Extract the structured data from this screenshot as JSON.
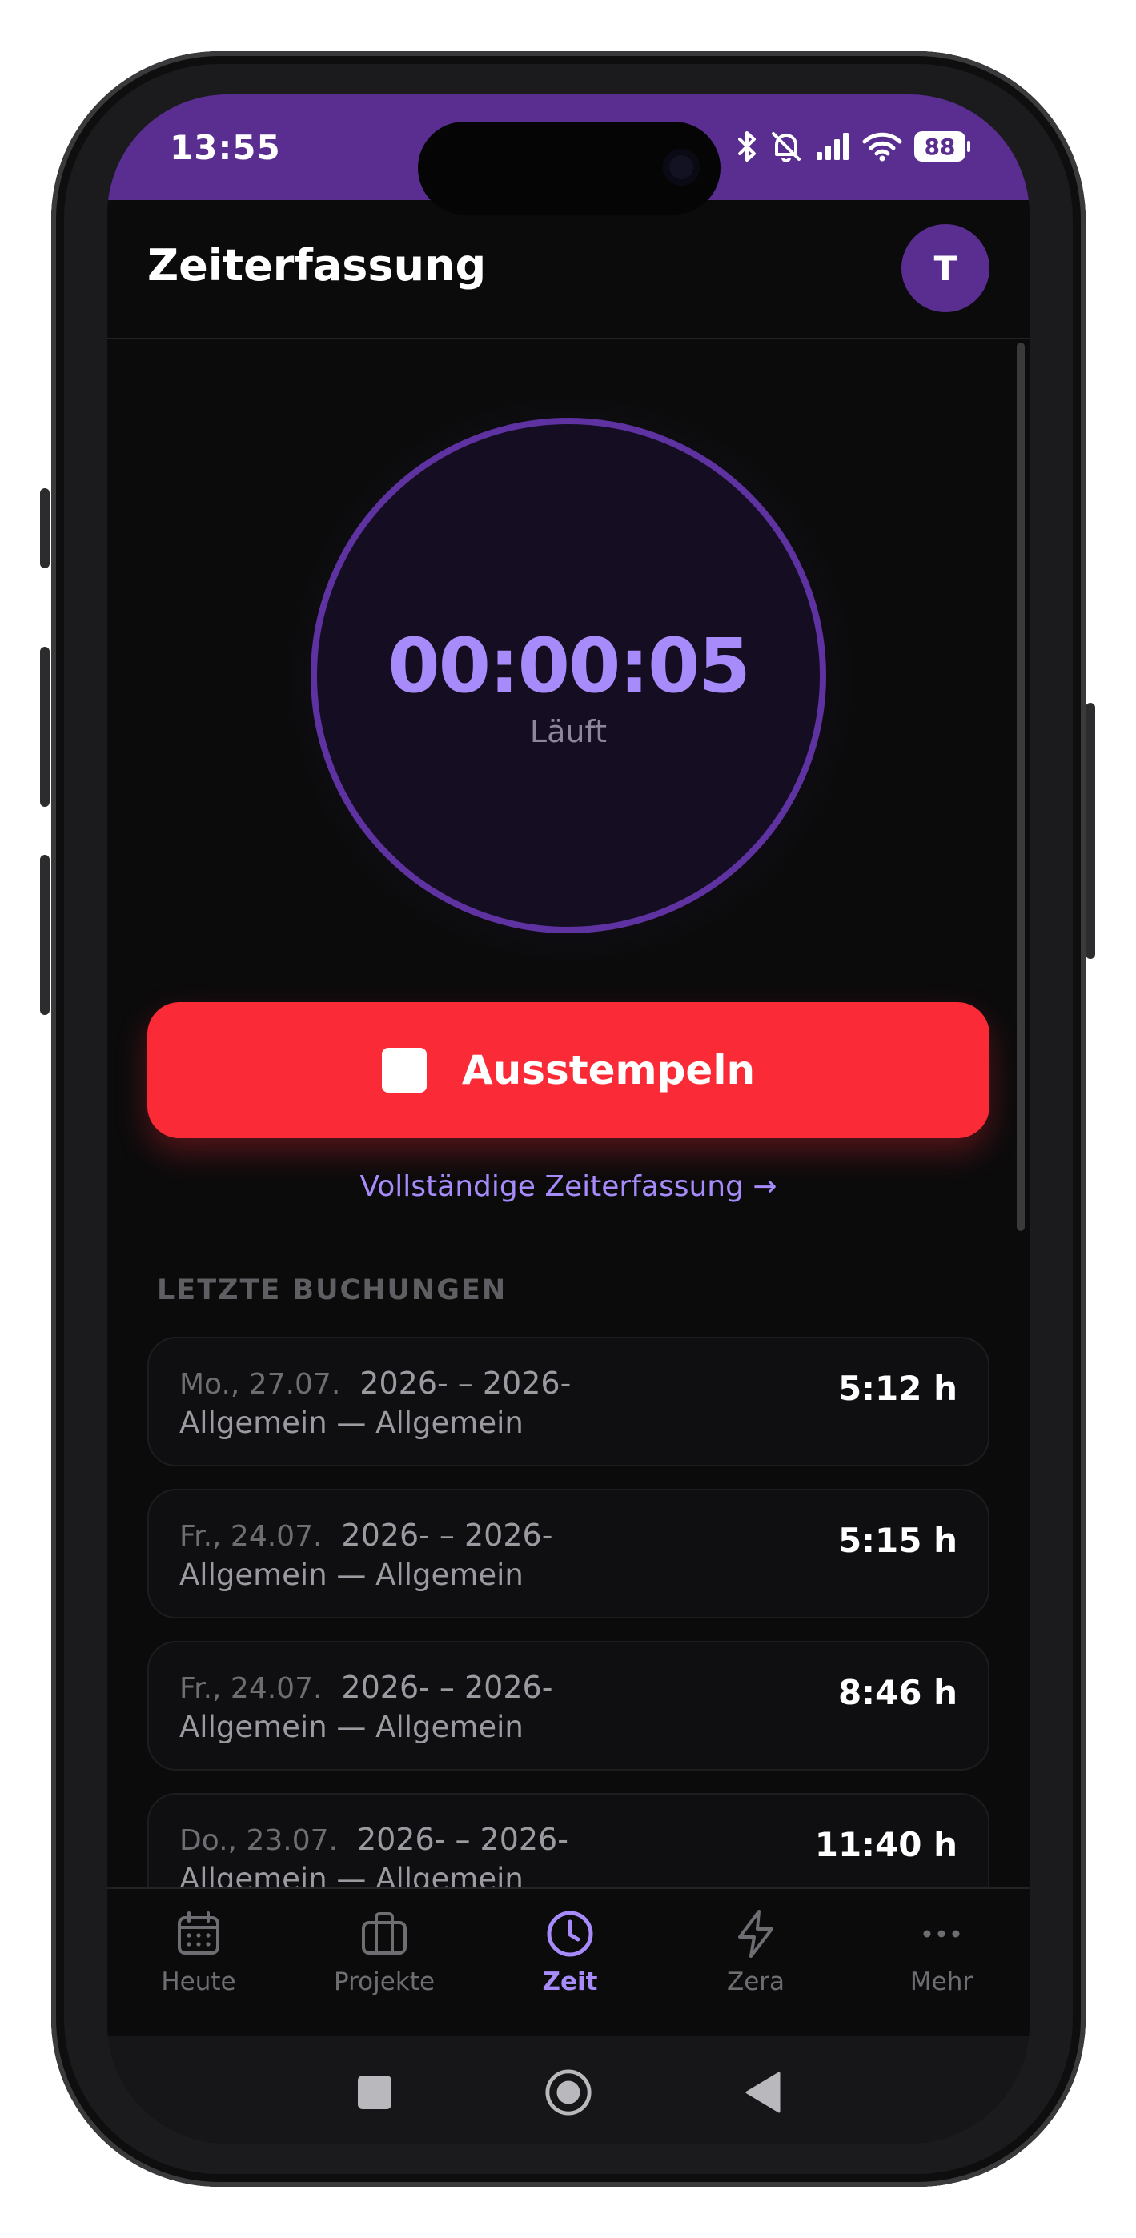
{
  "status_bar": {
    "time": "13:55",
    "battery": "88"
  },
  "header": {
    "title": "Zeiterfassung",
    "avatar_initial": "T"
  },
  "timer": {
    "elapsed": "00:00:05",
    "state": "Läuft"
  },
  "actions": {
    "clock_out_label": "Ausstempeln",
    "full_tracking_link": "Vollständige Zeiterfassung →"
  },
  "recent": {
    "heading": "LETZTE BUCHUNGEN",
    "items": [
      {
        "date": "Mo., 27.07.",
        "time_range": "2026- – 2026-",
        "project": "Allgemein — Allgemein",
        "duration": "5:12 h"
      },
      {
        "date": "Fr., 24.07.",
        "time_range": "2026- – 2026-",
        "project": "Allgemein — Allgemein",
        "duration": "5:15 h"
      },
      {
        "date": "Fr., 24.07.",
        "time_range": "2026- – 2026-",
        "project": "Allgemein — Allgemein",
        "duration": "8:46 h"
      },
      {
        "date": "Do., 23.07.",
        "time_range": "2026- – 2026-",
        "project": "Allgemein — Allgemein",
        "duration": "11:40 h"
      }
    ]
  },
  "nav": {
    "items": [
      {
        "label": "Heute",
        "icon": "calendar-icon"
      },
      {
        "label": "Projekte",
        "icon": "briefcase-icon"
      },
      {
        "label": "Zeit",
        "icon": "clock-icon",
        "active": true
      },
      {
        "label": "Zera",
        "icon": "lightning-icon"
      },
      {
        "label": "Mehr",
        "icon": "more-icon"
      }
    ]
  },
  "colors": {
    "accent": "#a78bfa",
    "brand": "#5a2d91",
    "danger": "#fb2a37",
    "background": "#0b0b0c"
  }
}
